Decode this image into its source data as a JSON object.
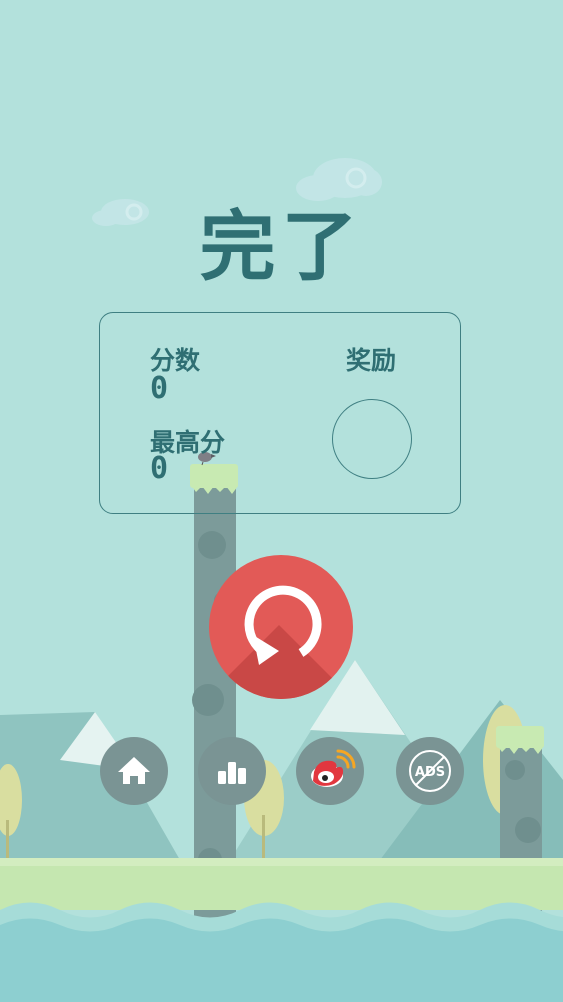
{
  "title": "完了",
  "panel": {
    "score_label": "分数",
    "score_value": "0",
    "best_label": "最高分",
    "best_value": "0",
    "medal_label": "奖励"
  },
  "buttons": {
    "restart_icon": "restart-icon",
    "home_icon": "home-icon",
    "leaderboard_icon": "leaderboard-icon",
    "weibo_icon": "weibo-icon",
    "no_ads_icon": "no-ads-icon",
    "no_ads_text": "ADS"
  },
  "colors": {
    "sky": "#b3e1dc",
    "title": "#2f6f73",
    "restart": "#e25a57",
    "button": "#7a9494",
    "grass": "#c5e7b0",
    "water": "#8dcfd0"
  }
}
